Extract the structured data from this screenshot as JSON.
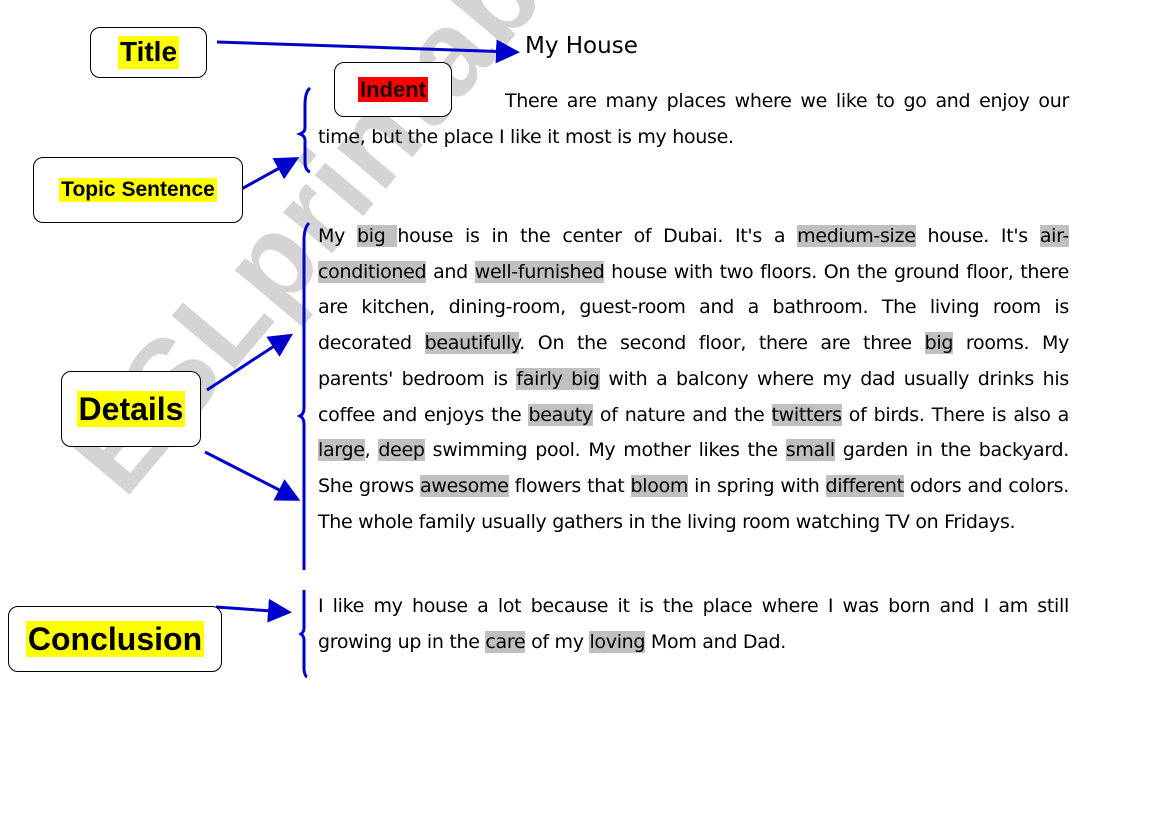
{
  "labels": {
    "title": "Title",
    "indent": "Indent",
    "topic_sentence": "Topic Sentence",
    "details": "Details",
    "conclusion": "Conclusion"
  },
  "colors": {
    "label_highlight": "#ffff00",
    "indent_highlight": "#ff0000",
    "arrow": "#0000cc",
    "word_highlight": "#c0c0c0"
  },
  "essay": {
    "title": "My House",
    "topic_paragraph": "There are many places where we like to go and enjoy our time, but the place I like it most is my house.",
    "details_paragraph": [
      {
        "t": "My "
      },
      {
        "t": "big ",
        "hl": true
      },
      {
        "t": " house is in the center of Dubai. It's a "
      },
      {
        "t": "medium-size",
        "hl": true
      },
      {
        "t": " house. It's "
      },
      {
        "t": "air-conditioned",
        "hl": true
      },
      {
        "t": " and "
      },
      {
        "t": "well-furnished",
        "hl": true
      },
      {
        "t": " house with two floors. On the ground floor, there are kitchen, dining-room, guest-room and a bathroom. The living room is decorated "
      },
      {
        "t": "beautifully",
        "hl": true
      },
      {
        "t": ". On the second floor, there are three "
      },
      {
        "t": "big",
        "hl": true
      },
      {
        "t": " rooms. My parents' bedroom is "
      },
      {
        "t": "fairly big",
        "hl": true
      },
      {
        "t": " with a balcony where my dad usually drinks his coffee and enjoys the "
      },
      {
        "t": "beauty",
        "hl": true
      },
      {
        "t": " of nature and the "
      },
      {
        "t": "twitters",
        "hl": true
      },
      {
        "t": " of birds. There is also a "
      },
      {
        "t": "large",
        "hl": true
      },
      {
        "t": ", "
      },
      {
        "t": "deep",
        "hl": true
      },
      {
        "t": " swimming pool. My mother likes the "
      },
      {
        "t": "small",
        "hl": true
      },
      {
        "t": " garden in the backyard. She grows "
      },
      {
        "t": "awesome",
        "hl": true
      },
      {
        "t": " flowers that "
      },
      {
        "t": "bloom",
        "hl": true
      },
      {
        "t": " in spring with "
      },
      {
        "t": "different",
        "hl": true
      },
      {
        "t": " odors and colors. The whole family usually gathers in the living room watching TV on Fridays."
      }
    ],
    "conclusion_paragraph": [
      {
        "t": "I like my house a lot because it is the place where I was born and I am still growing up in the "
      },
      {
        "t": "care",
        "hl": true
      },
      {
        "t": " of my "
      },
      {
        "t": "loving",
        "hl": true
      },
      {
        "t": " Mom and Dad."
      }
    ]
  },
  "watermark": "ESLprintables.com"
}
